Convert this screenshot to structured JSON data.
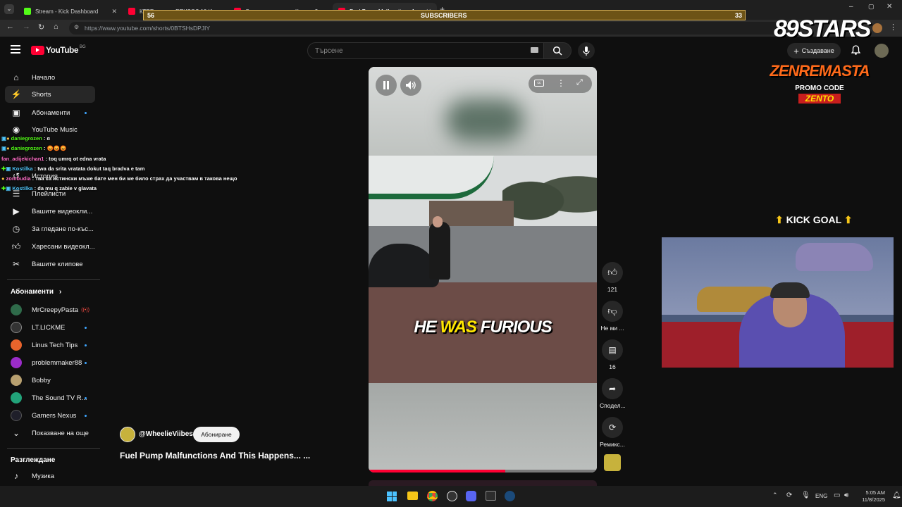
{
  "browser": {
    "tabs": [
      {
        "title": "Stream - Kick Dashboard",
        "favicon_color": "#53fc18",
        "active": false
      },
      {
        "title": "КТРЕ начало ЕПИЗОД 10 'А...",
        "favicon_color": "#ff0033",
        "active": false
      },
      {
        "title": "Огромни пазарко - Къде е 3...",
        "favicon_color": "#ff0033",
        "active": false
      },
      {
        "title": "Fuel Pump Malfunctions A...",
        "favicon_color": "#ff0033",
        "active": true
      }
    ],
    "url": "https://www.youtube.com/shorts/0BTSHsDPJIY"
  },
  "overlay": {
    "subs_bar": {
      "label": "SUBSCRIBERS",
      "left": "56",
      "right": "33",
      "progress": 0.0
    },
    "stars_logo": "89STARS",
    "promo_brand": "ZENREMASTA",
    "promo_label": "PROMO CODE",
    "promo_code": "ZENTO",
    "kick_goal": "KICK GOAL",
    "chat": [
      {
        "user": "daniegrozen",
        "msg": ": я",
        "color": "#53fc18"
      },
      {
        "user": "daniegrozen",
        "msg": ": 😡😡😡",
        "color": "#53fc18"
      },
      {
        "user": "fan_adijekichan1",
        "msg": ": toq umrq ot edna vrata",
        "color": "#ff6ec7"
      },
      {
        "user": "Kostilka",
        "msg": ": twa da srita vratata dokut taq bradva e tam",
        "color": "#4fc3f7"
      },
      {
        "user": "zombudia",
        "msg": ": тва са истински мъже бате мен би ме било страх да участвам в такова нещо",
        "color": "#ff6ec7"
      },
      {
        "user": "Kostilka",
        "msg": ": da mu q zabie v glavata",
        "color": "#4fc3f7"
      }
    ]
  },
  "youtube": {
    "logo": "YouTube",
    "region": "BG",
    "search_placeholder": "Търсене",
    "create_label": "Създаване",
    "sidebar": [
      {
        "label": "Начало",
        "icon": "home-icon"
      },
      {
        "label": "Shorts",
        "icon": "shorts-icon",
        "active": true
      },
      {
        "label": "Абонаменти",
        "icon": "subscriptions-icon",
        "dot": true
      },
      {
        "label": "YouTube Music",
        "icon": "music-icon"
      }
    ],
    "sidebar2": [
      {
        "label": "История",
        "icon": "history-icon"
      },
      {
        "label": "Плейлисти",
        "icon": "playlist-icon"
      },
      {
        "label": "Вашите видеокли...",
        "icon": "your-videos-icon"
      },
      {
        "label": "За гледане по-къс...",
        "icon": "watch-later-icon"
      },
      {
        "label": "Харесани видеокл...",
        "icon": "liked-icon"
      },
      {
        "label": "Вашите клипове",
        "icon": "clips-icon"
      }
    ],
    "subs_heading": "Абонаменти",
    "subscriptions": [
      {
        "name": "MrCreepyPasta",
        "color": "#2f6b4a",
        "live": true
      },
      {
        "name": "LT.LICKME",
        "color": "#333333"
      },
      {
        "name": "Linus Tech Tips",
        "color": "#e8642c"
      },
      {
        "name": "problemmaker88",
        "color": "#9b2cc9"
      },
      {
        "name": "Bobby",
        "color": "#b8a070"
      },
      {
        "name": "The Sound TV R...",
        "color": "#22a37a"
      },
      {
        "name": "Gamers Nexus",
        "color": "#1f1f2a"
      }
    ],
    "show_more": "Показване на още",
    "explore_heading": "Разглеждане",
    "explore": [
      {
        "label": "Музика",
        "icon": "music-note-icon"
      }
    ],
    "short": {
      "channel": "@WheelieViibes",
      "subscribe": "Абониране",
      "title": "Fuel Pump Malfunctions And This Happens... ...",
      "caption_a": "HE",
      "caption_b": "WAS",
      "caption_c": "FURIOUS",
      "likes": "121",
      "dislike": "Не ми ...",
      "comments": "16",
      "share": "Сподел...",
      "remix": "Ремикс...",
      "progress": 0.6
    }
  },
  "taskbar": {
    "lang": "ENG",
    "time": "5:05 AM",
    "date": "11/8/2025"
  }
}
